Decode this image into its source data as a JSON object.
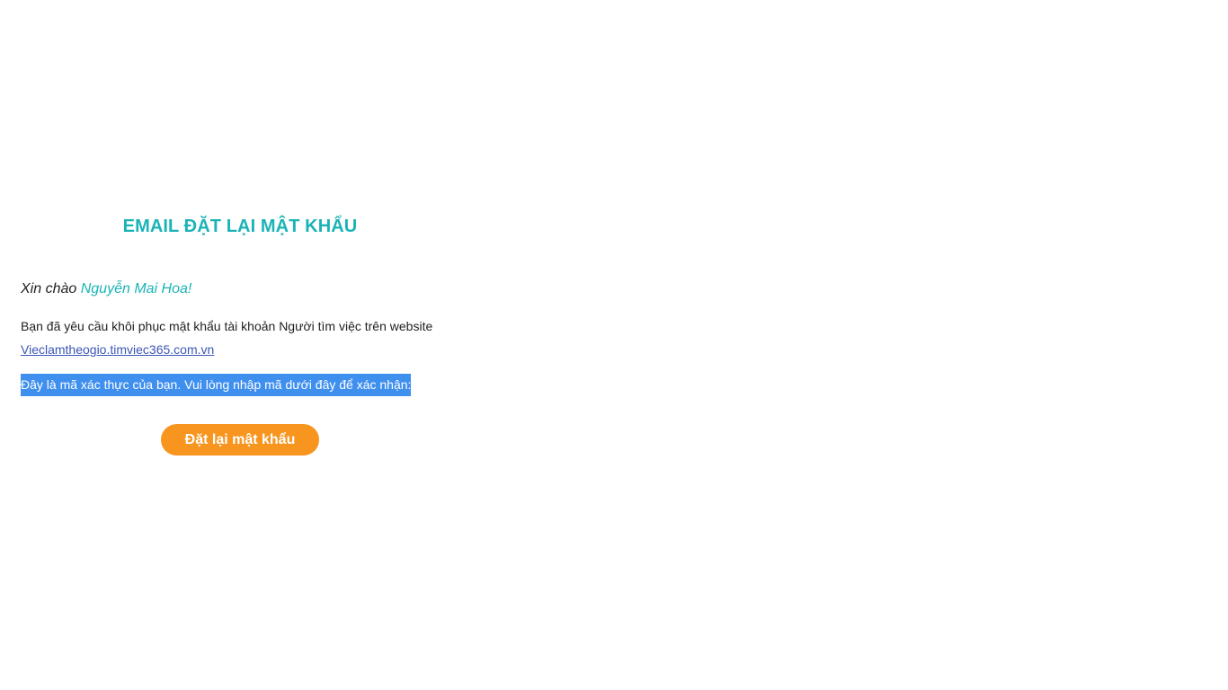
{
  "email": {
    "title": "EMAIL ĐẶT LẠI MẬT KHẨU",
    "greeting": {
      "prefix": "Xin chào",
      "name": "Nguyễn Mai Hoa!"
    },
    "body_text": "Bạn đã yêu cầu khôi phục mật khẩu tài khoản Người tìm việc trên website",
    "website_link": "Vieclamtheogio.timviec365.com.vn",
    "code_instruction": "Đây là mã xác thực của bạn. Vui lòng nhập mã dưới đây để xác nhận:",
    "reset_button_label": "Đặt lại mật khẩu"
  },
  "colors": {
    "accent": "#1bb3b6",
    "button": "#f7951e",
    "link": "#3b56b6",
    "selection": "#3f8fef"
  }
}
